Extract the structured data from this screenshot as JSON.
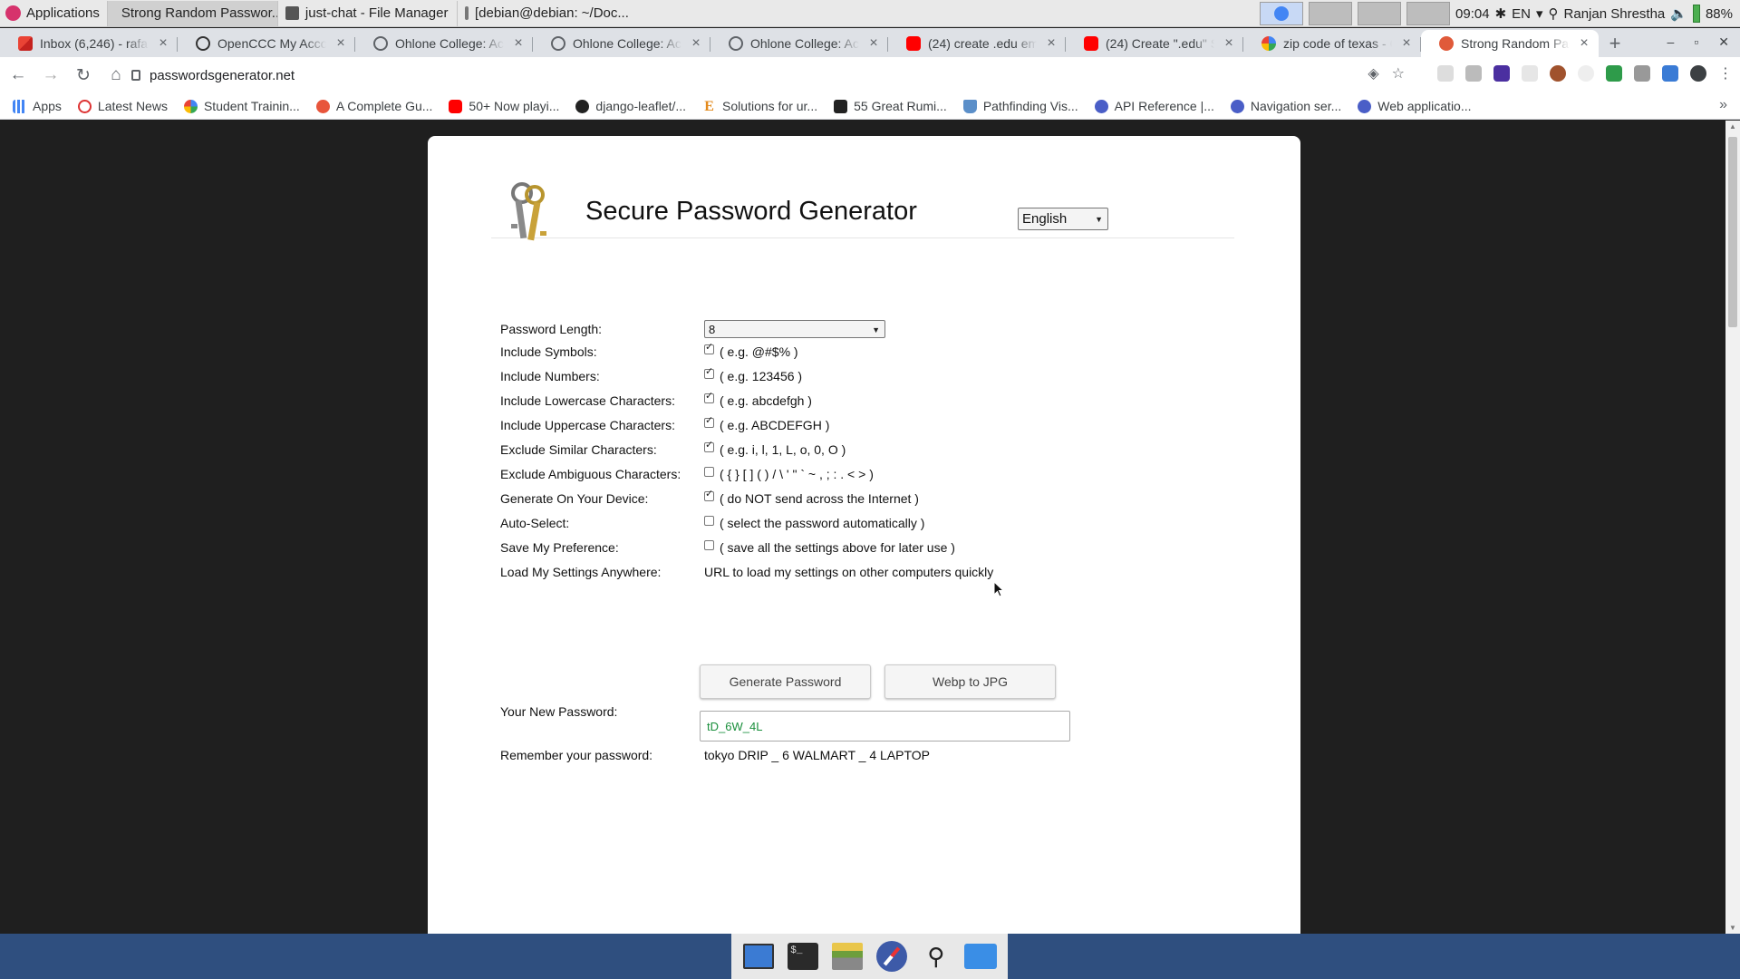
{
  "desktop": {
    "applications_label": "Applications",
    "tasks": [
      {
        "label": "Strong Random Passwor...",
        "icon": "chrome-icon",
        "active": true
      },
      {
        "label": "just-chat - File Manager",
        "icon": "folder-icon",
        "active": false
      },
      {
        "label": "[debian@debian: ~/Doc...",
        "icon": "terminal-icon",
        "active": false
      }
    ],
    "clock": "09:04",
    "keyboard_layout": "EN",
    "user_name": "Ranjan Shrestha",
    "battery": "88%"
  },
  "browser": {
    "tabs": [
      {
        "label": "Inbox (6,246) - rafa",
        "favicon": "gmail-icon"
      },
      {
        "label": "OpenCCC My Accou",
        "favicon": "openccc-icon"
      },
      {
        "label": "Ohlone College: Acc",
        "favicon": "globe-icon"
      },
      {
        "label": "Ohlone College: Acc",
        "favicon": "globe-icon"
      },
      {
        "label": "Ohlone College: Acc",
        "favicon": "globe-icon"
      },
      {
        "label": "(24) create .edu em",
        "favicon": "youtube-icon"
      },
      {
        "label": "(24) Create \".edu\" S",
        "favicon": "youtube-icon"
      },
      {
        "label": "zip code of texas - G",
        "favicon": "google-icon"
      },
      {
        "label": "Strong Random Pas",
        "favicon": "key-icon",
        "active": true
      }
    ],
    "url": "passwordsgenerator.net",
    "bookmarks": [
      {
        "label": "Apps",
        "icon": "apps-grid-icon"
      },
      {
        "label": "Latest News",
        "icon": "news-icon"
      },
      {
        "label": "Student Trainin...",
        "icon": "google-icon"
      },
      {
        "label": "A Complete Gu...",
        "icon": "star-badge-icon"
      },
      {
        "label": "50+ Now playi...",
        "icon": "youtube-icon"
      },
      {
        "label": "django-leaflet/...",
        "icon": "github-icon"
      },
      {
        "label": "Solutions for ur...",
        "icon": "letter-e-icon"
      },
      {
        "label": "55 Great Rumi...",
        "icon": "checkbox-icon"
      },
      {
        "label": "Pathfinding Vis...",
        "icon": "flask-icon"
      },
      {
        "label": "API Reference |...",
        "icon": "circle-link-icon"
      },
      {
        "label": "Navigation ser...",
        "icon": "circle-link-icon"
      },
      {
        "label": "Web applicatio...",
        "icon": "circle-link-icon"
      }
    ]
  },
  "page": {
    "title": "Secure Password Generator",
    "language": "English",
    "options": [
      {
        "label": "Password Length:",
        "type": "select",
        "value": "8"
      },
      {
        "label": "Include Symbols:",
        "type": "checkbox",
        "checked": true,
        "hint": "( e.g. @#$% )"
      },
      {
        "label": "Include Numbers:",
        "type": "checkbox",
        "checked": true,
        "hint": "( e.g. 123456 )"
      },
      {
        "label": "Include Lowercase Characters:",
        "type": "checkbox",
        "checked": true,
        "hint": "( e.g. abcdefgh )"
      },
      {
        "label": "Include Uppercase Characters:",
        "type": "checkbox",
        "checked": true,
        "hint": "( e.g. ABCDEFGH )"
      },
      {
        "label": "Exclude Similar Characters:",
        "type": "checkbox",
        "checked": true,
        "hint": "( e.g. i, l, 1, L, o, 0, O )"
      },
      {
        "label": "Exclude Ambiguous Characters:",
        "type": "checkbox",
        "checked": false,
        "hint": "( { } [ ] ( ) / \\ ' \" ` ~ , ; : . < > )"
      },
      {
        "label": "Generate On Your Device:",
        "type": "checkbox",
        "checked": true,
        "hint": "( do NOT send across the Internet )"
      },
      {
        "label": "Auto-Select:",
        "type": "checkbox",
        "checked": false,
        "hint": "( select the password automatically )"
      },
      {
        "label": "Save My Preference:",
        "type": "checkbox",
        "checked": false,
        "hint": "( save all the settings above for later use )"
      },
      {
        "label": "Load My Settings Anywhere:",
        "type": "text",
        "hint": "URL to load my settings on other computers quickly"
      }
    ],
    "generate_button": "Generate Password",
    "webp_button": "Webp to JPG",
    "new_password_label": "Your New Password:",
    "new_password": "tD_6W_4L",
    "remember_label": "Remember your password:",
    "remember_phrase": "tokyo DRIP _ 6 WALMART _ 4 LAPTOP"
  }
}
